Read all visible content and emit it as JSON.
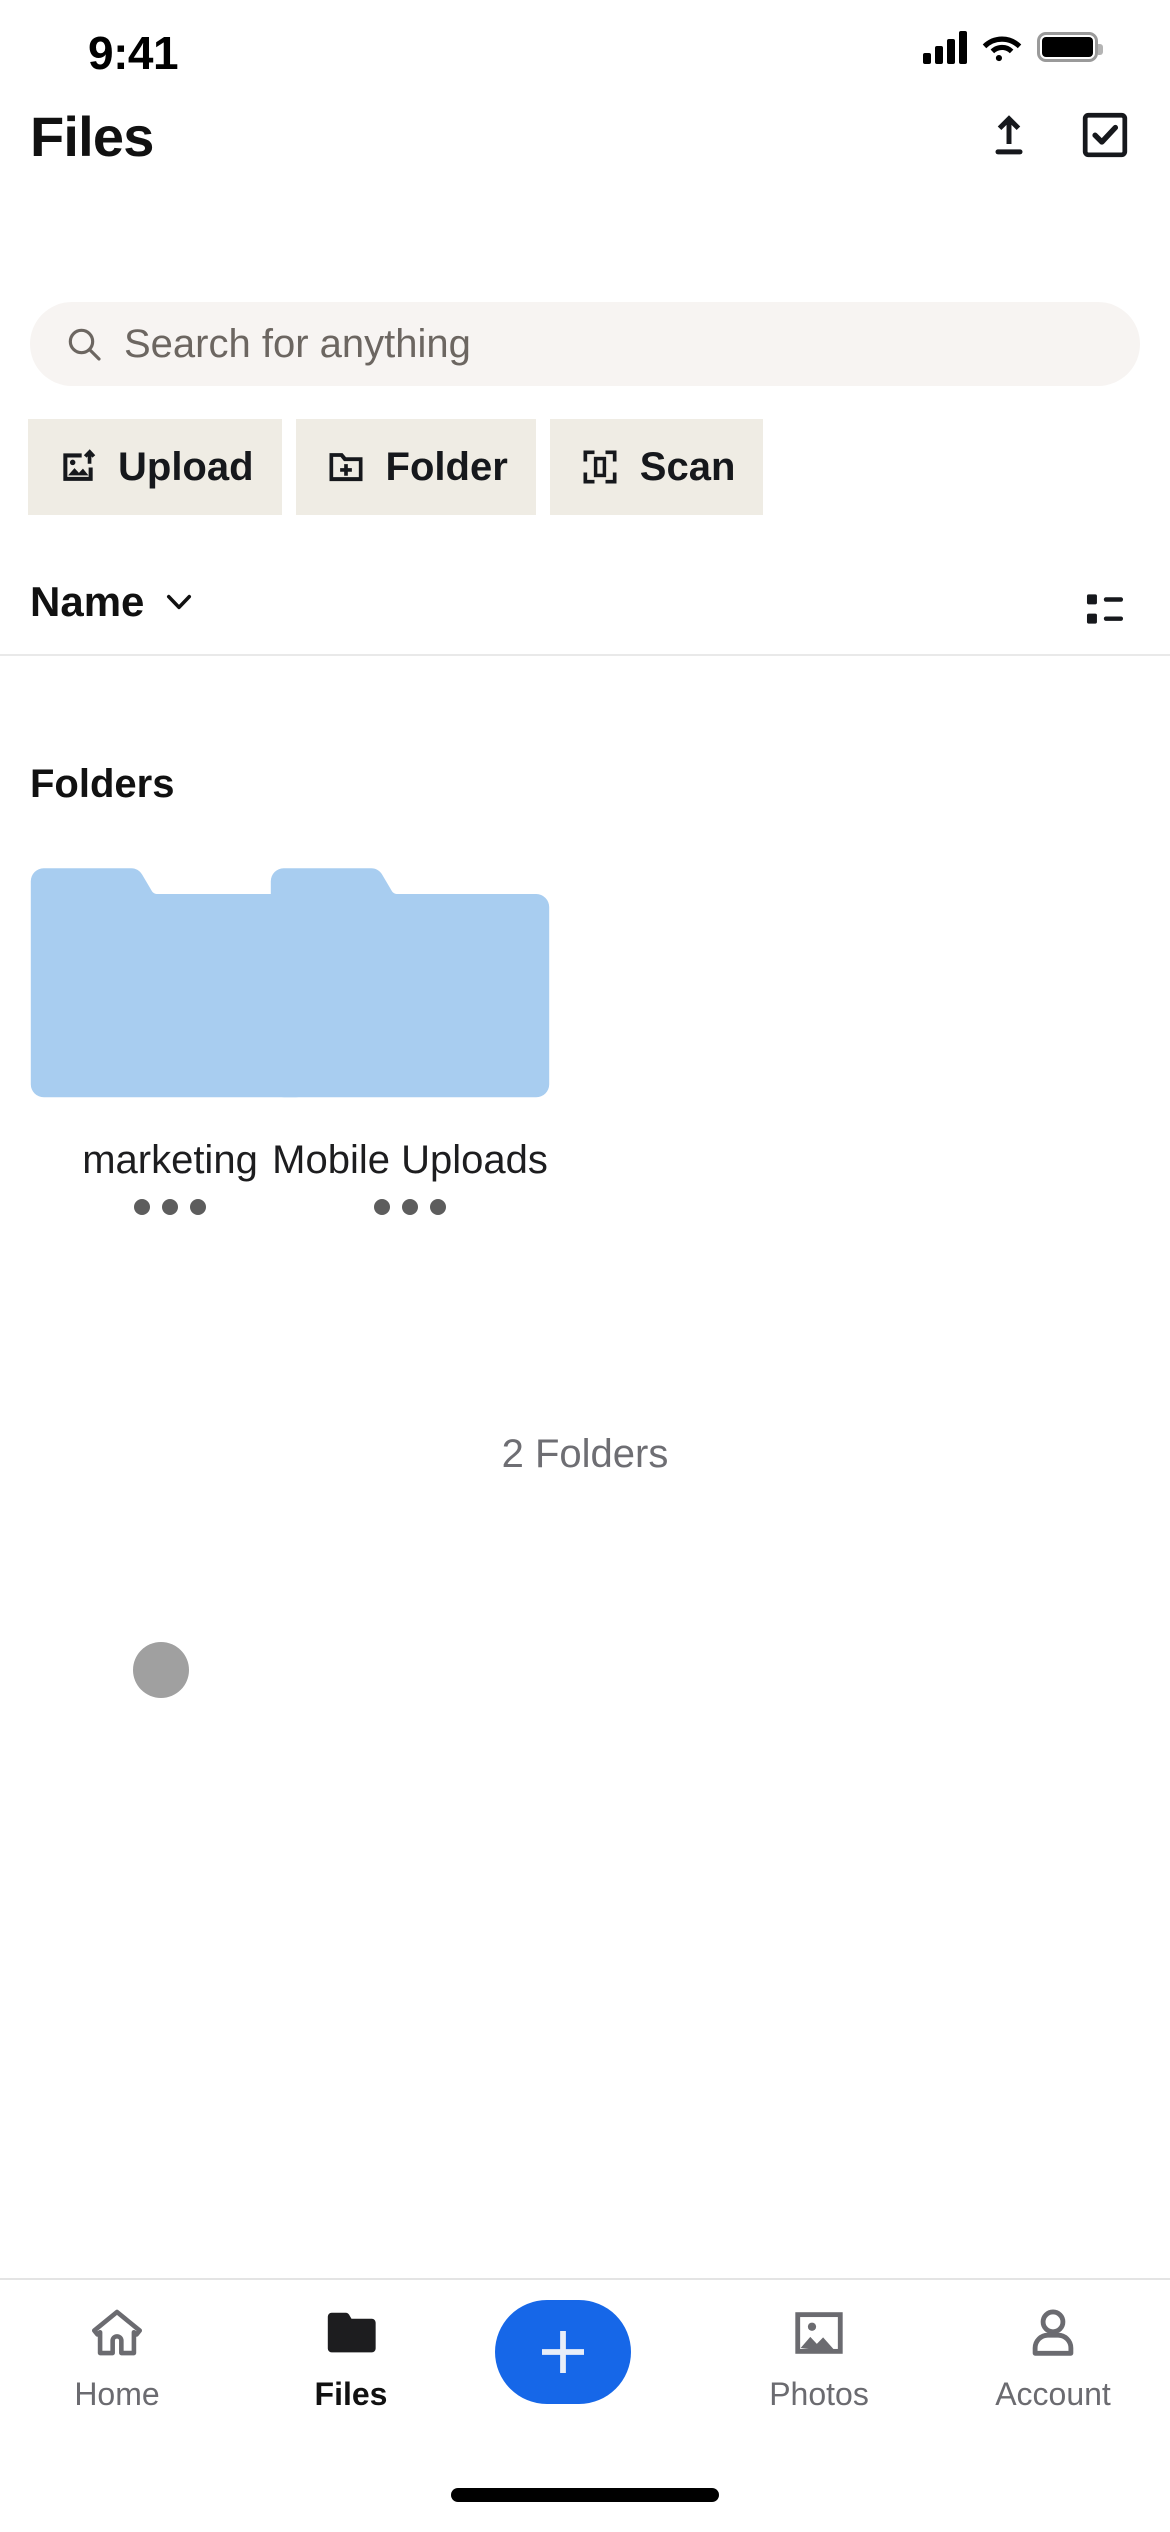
{
  "status_bar": {
    "time": "9:41",
    "icons": [
      "cellular-signal-icon",
      "wifi-icon",
      "battery-icon"
    ]
  },
  "header": {
    "title": "Files",
    "upload_label": "Upload",
    "select_label": "Select",
    "icons": [
      "upload-icon",
      "select-checkbox-icon"
    ]
  },
  "search": {
    "placeholder": "Search for anything",
    "value": "",
    "icon": "search-icon"
  },
  "quick_actions": [
    {
      "label": "Upload",
      "icon": "image-upload-icon"
    },
    {
      "label": "Folder",
      "icon": "folder-plus-icon"
    },
    {
      "label": "Scan",
      "icon": "scan-frame-icon"
    }
  ],
  "sort": {
    "label": "Name",
    "chevron_icon": "chevron-down-icon",
    "view_toggle_icon": "list-view-icon"
  },
  "content": {
    "section_title": "Folders",
    "folders": [
      {
        "name": "marketing",
        "overflow_icon": "more-horizontal-icon"
      },
      {
        "name": "Mobile Uploads",
        "overflow_icon": "more-horizontal-icon"
      }
    ],
    "count_label": "2 Folders"
  },
  "tab_bar": {
    "items": [
      {
        "label": "Home",
        "icon": "home-icon",
        "active": false
      },
      {
        "label": "Files",
        "icon": "folder-icon",
        "active": true
      },
      {
        "label": "Photos",
        "icon": "photo-icon",
        "active": false
      },
      {
        "label": "Account",
        "icon": "person-icon",
        "active": false
      }
    ],
    "fab": {
      "label": "Create",
      "icon": "plus-icon"
    }
  },
  "colors": {
    "accent": "#1667e8",
    "folder_blue": "#a8cdf0",
    "chip_bg": "#efece4",
    "search_bg": "#f7f4f2",
    "text_primary": "#111111",
    "text_muted": "#6e6e73"
  }
}
